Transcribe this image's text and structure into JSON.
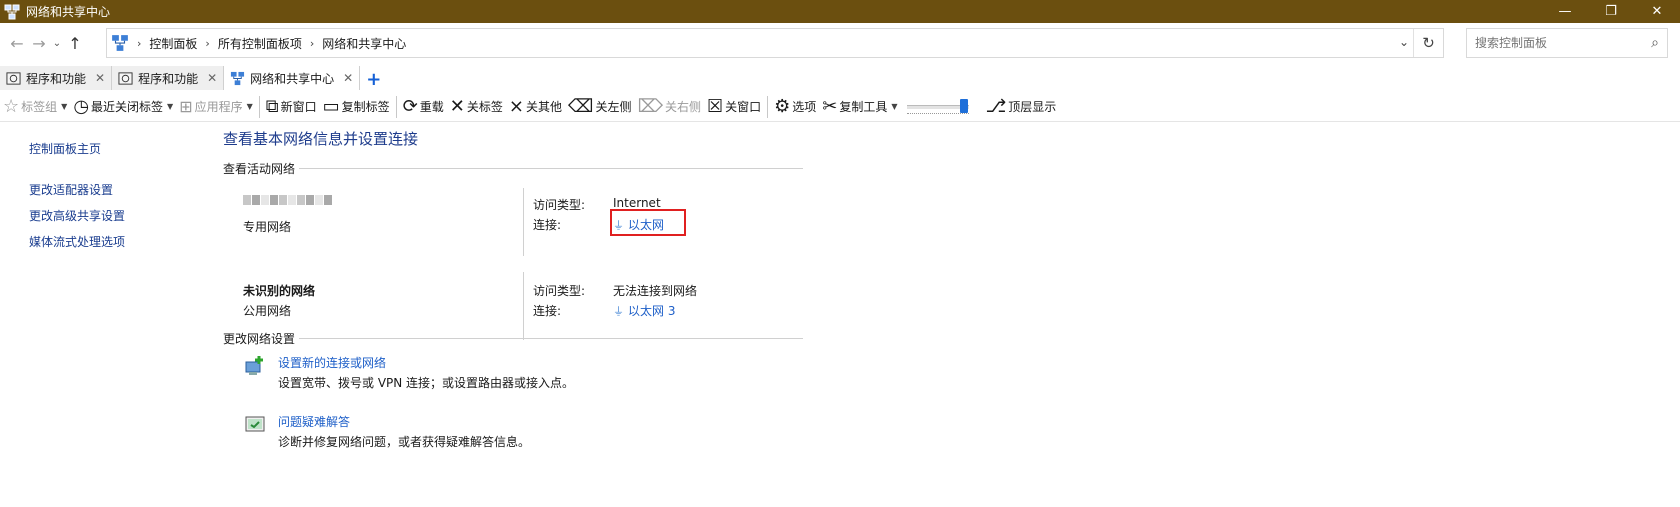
{
  "titlebar": {
    "title": "网络和共享中心",
    "minimize": "—",
    "restore": "❐",
    "close": "✕"
  },
  "address": {
    "breadcrumbs": [
      "控制面板",
      "所有控制面板项",
      "网络和共享中心"
    ],
    "search_placeholder": "搜索控制面板"
  },
  "tabs": [
    {
      "label": "程序和功能",
      "active": false
    },
    {
      "label": "程序和功能",
      "active": false
    },
    {
      "label": "网络和共享中心",
      "active": true
    }
  ],
  "toolbar": {
    "bookmarks": "标签组",
    "recent_closed": "最近关闭标签",
    "apps": "应用程序",
    "new_window": "新窗口",
    "copy_tab": "复制标签",
    "reload": "重载",
    "close_tab": "关标签",
    "close_others": "关其他",
    "close_left": "关左侧",
    "close_right": "关右侧",
    "close_window": "关窗口",
    "options": "选项",
    "copy_tools": "复制工具",
    "slider_value": 0.85,
    "top_display": "顶层显示"
  },
  "sidebar": {
    "items": [
      "控制面板主页",
      "更改适配器设置",
      "更改高级共享设置",
      "媒体流式处理选项"
    ]
  },
  "main": {
    "title": "查看基本网络信息并设置连接",
    "active_networks_header": "查看活动网络",
    "networks": [
      {
        "name": "",
        "category": "专用网络",
        "access_label": "访问类型:",
        "access_value": "Internet",
        "connection_label": "连接:",
        "connection_value": "以太网"
      },
      {
        "name": "未识别的网络",
        "category": "公用网络",
        "access_label": "访问类型:",
        "access_value": "无法连接到网络",
        "connection_label": "连接:",
        "connection_value": "以太网 3"
      }
    ],
    "change_settings_header": "更改网络设置",
    "tasks": [
      {
        "title": "设置新的连接或网络",
        "desc": "设置宽带、拨号或 VPN 连接；或设置路由器或接入点。"
      },
      {
        "title": "问题疑难解答",
        "desc": "诊断并修复网络问题，或者获得疑难解答信息。"
      }
    ]
  },
  "colors": {
    "titlebar": "#6b4f0f",
    "link": "#1e5fc8",
    "heading": "#1e3c8c",
    "highlight": "#e02020"
  }
}
